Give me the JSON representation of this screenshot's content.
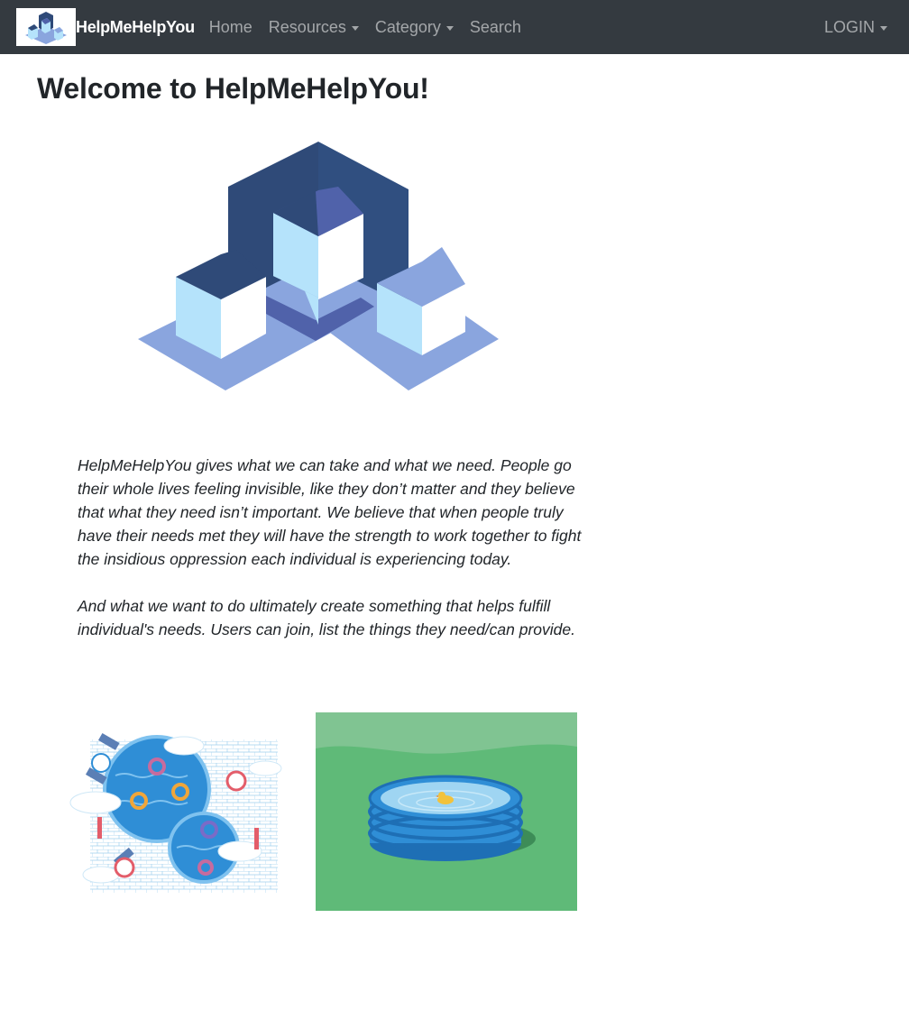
{
  "nav": {
    "brand": "HelpMeHelpYou",
    "items": [
      {
        "label": "Home",
        "dropdown": false
      },
      {
        "label": "Resources",
        "dropdown": true
      },
      {
        "label": "Category",
        "dropdown": true
      },
      {
        "label": "Search",
        "dropdown": false
      }
    ],
    "login": "LOGIN"
  },
  "main": {
    "title": "Welcome to HelpMeHelpYou!",
    "paragraphs": [
      "HelpMeHelpYou gives what we can take and what we need. People go their whole lives feeling invisible, like they don’t matter and they believe that what they need isn’t important. We believe that when people truly have their needs met they will have the strength to work together to fight the insidious oppression each individual is experiencing today.",
      "And what we want to do ultimately create something that helps fulfill individual's needs. Users can join, list the things they need/can provide."
    ]
  },
  "images": {
    "hero": "houses-illustration",
    "gallery": [
      "pool-illustration",
      "kiddie-pool-illustration"
    ]
  },
  "colors": {
    "navbar": "#343a40",
    "dark_blue": "#2f4a78",
    "mid_blue": "#5062aa",
    "light_blue": "#8aa5de",
    "house_wall": "#b5e3fb",
    "grass": "#5fba78",
    "water": "#2f8ed6"
  }
}
